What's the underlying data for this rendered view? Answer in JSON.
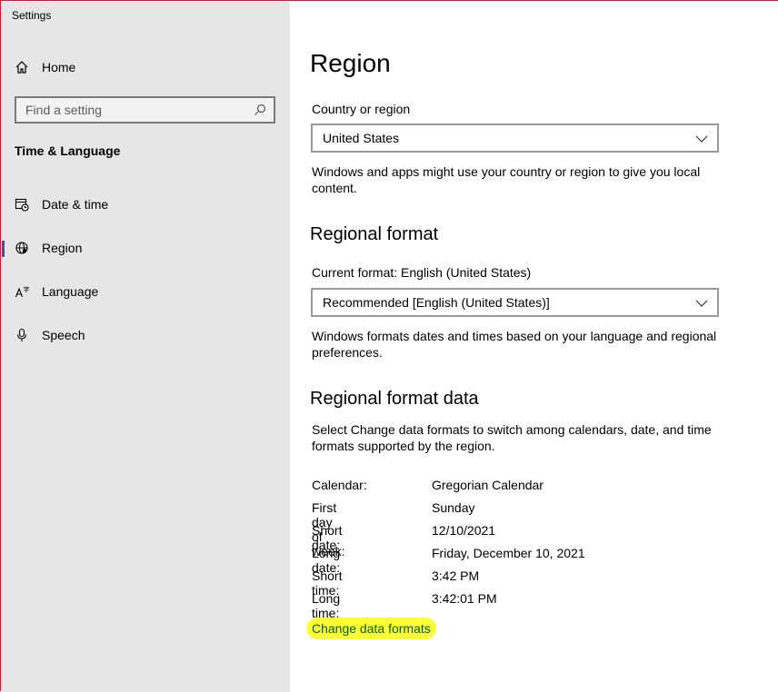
{
  "app": {
    "title": "Settings"
  },
  "sidebar": {
    "home_label": "Home",
    "search_placeholder": "Find a setting",
    "section_title": "Time & Language",
    "items": [
      {
        "label": "Date & time",
        "icon": "calendar-clock-icon"
      },
      {
        "label": "Region",
        "icon": "globe-icon",
        "selected": true
      },
      {
        "label": "Language",
        "icon": "language-icon"
      },
      {
        "label": "Speech",
        "icon": "microphone-icon"
      }
    ]
  },
  "main": {
    "title": "Region",
    "country": {
      "label": "Country or region",
      "value": "United States",
      "description": "Windows and apps might use your country or region to give you local content."
    },
    "regional_format": {
      "heading": "Regional format",
      "current": "Current format: English (United States)",
      "value": "Recommended [English (United States)]",
      "description": "Windows formats dates and times based on your language and regional preferences."
    },
    "format_data": {
      "heading": "Regional format data",
      "description": "Select Change data formats to switch among calendars, date, and time formats supported by the region.",
      "rows": [
        {
          "key": "Calendar:",
          "value": "Gregorian Calendar"
        },
        {
          "key": "First day of week:",
          "value": "Sunday"
        },
        {
          "key": "Short date:",
          "value": "12/10/2021"
        },
        {
          "key": "Long date:",
          "value": "Friday, December 10, 2021"
        },
        {
          "key": "Short time:",
          "value": "3:42 PM"
        },
        {
          "key": "Long time:",
          "value": "3:42:01 PM"
        }
      ],
      "link": "Change data formats"
    }
  },
  "colors": {
    "sidebar_bg": "#e6e6e6",
    "accent": "#5b4a8b",
    "highlight": "#ffff33",
    "link": "#006400"
  }
}
